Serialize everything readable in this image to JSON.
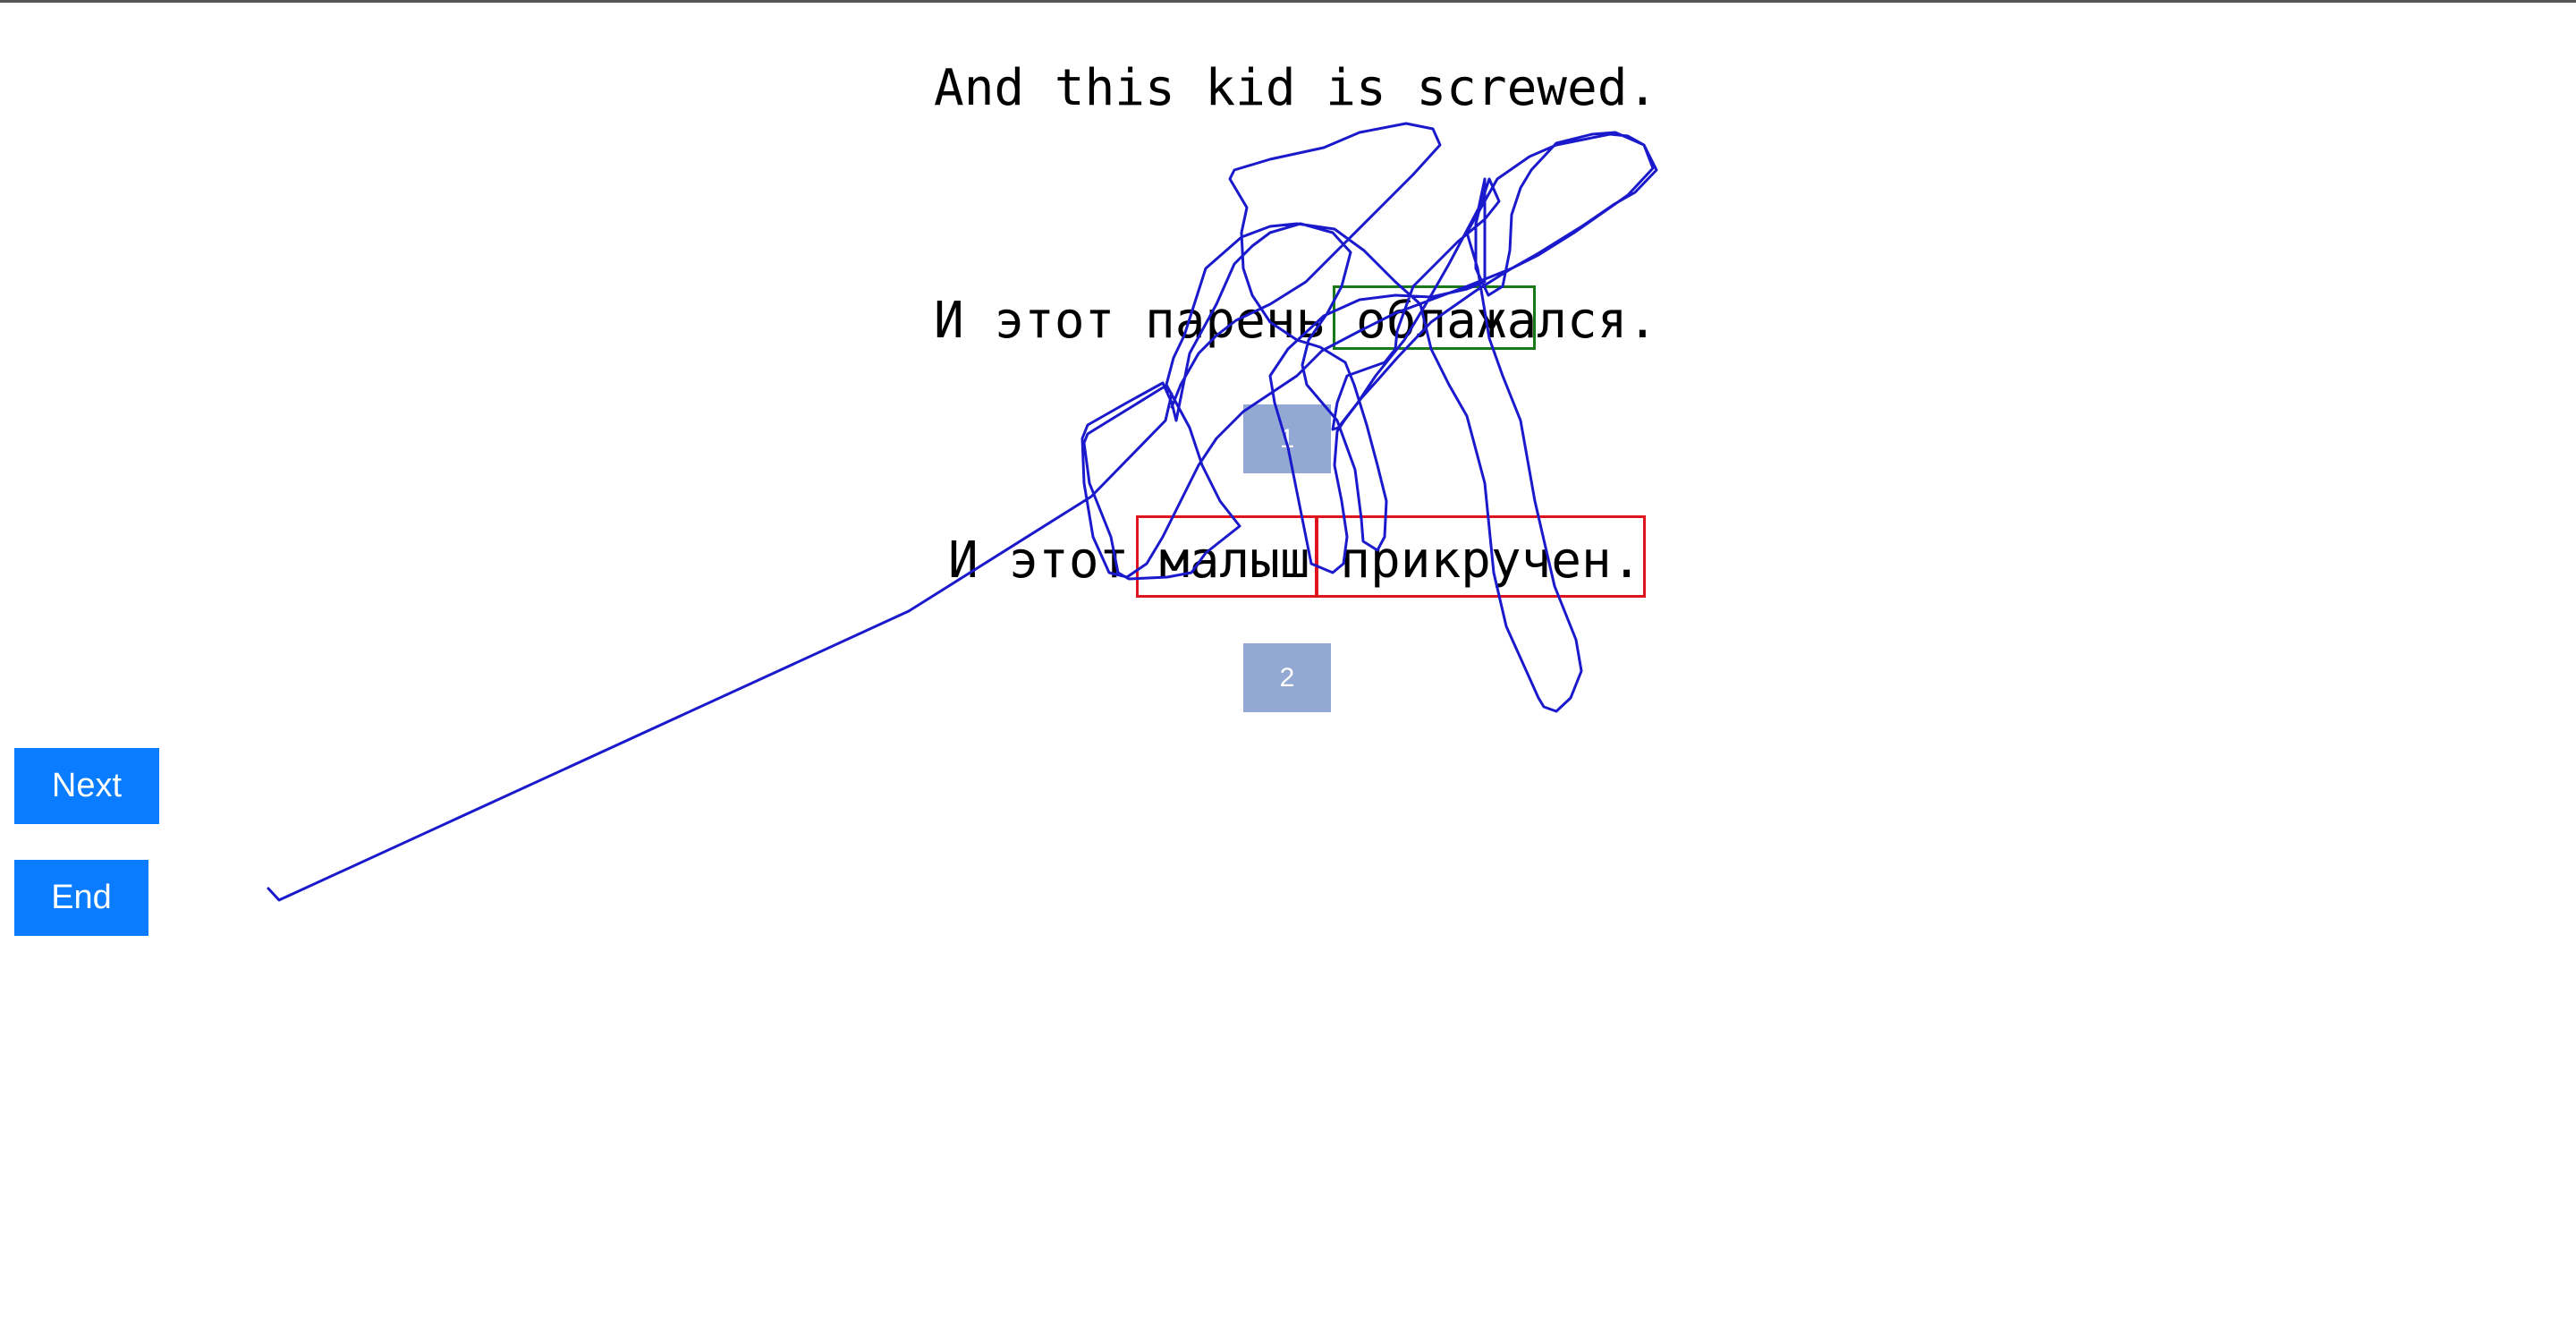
{
  "source_sentence": "And this kid is screwed.",
  "translations": [
    {
      "text": "И этот парень облажался.",
      "badge": "1",
      "highlight": "облажался"
    },
    {
      "text": "И этот малыш прикручен.",
      "badge": "2",
      "highlight": "малыш прикручен."
    }
  ],
  "buttons": {
    "next_label": "Next",
    "end_label": "End"
  },
  "colors": {
    "button_bg": "#0a7cff",
    "badge_bg": "#94a8d4",
    "good_highlight": "#1a7a1a",
    "bad_highlight": "#e0141e",
    "annotation_stroke": "#1a1acc"
  }
}
